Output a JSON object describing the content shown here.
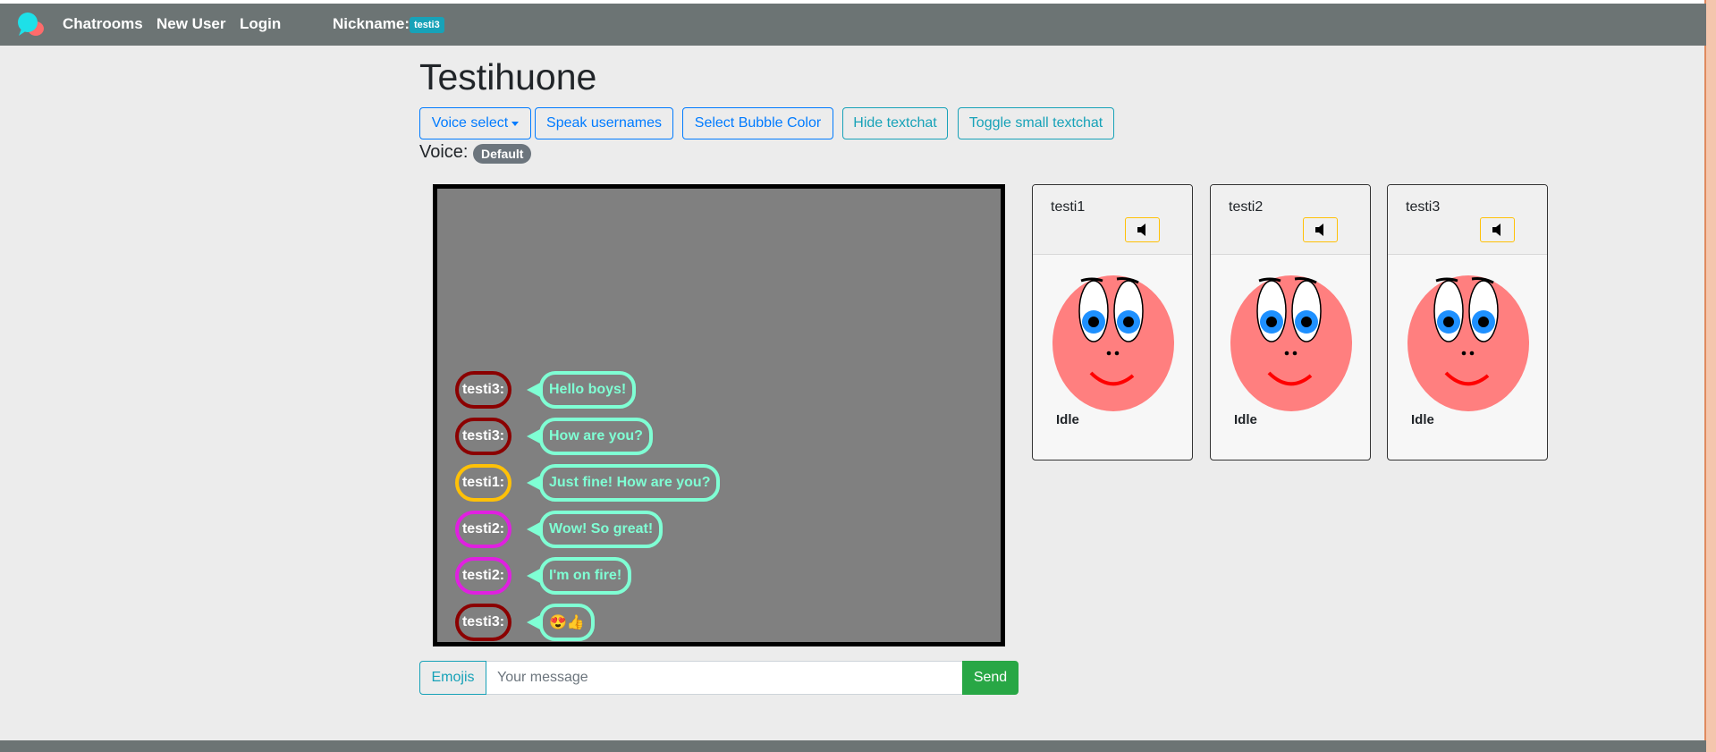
{
  "navbar": {
    "brand_icon": "chat-bubbles-logo-icon",
    "links": [
      "Chatrooms",
      "New User",
      "Login"
    ],
    "nickname_label": "Nickname:",
    "nickname_value": "testi3"
  },
  "room": {
    "title": "Testihuone",
    "buttons": {
      "voice_select": "Voice select",
      "speak_usernames": "Speak usernames",
      "select_bubble_color": "Select Bubble Color",
      "hide_textchat": "Hide textchat",
      "toggle_small_textchat": "Toggle small textchat"
    },
    "voice_label": "Voice:",
    "voice_value": "Default"
  },
  "chat": {
    "messages": [
      {
        "user": "testi3:",
        "text": "Hello boys!",
        "user_color": "#8b0000"
      },
      {
        "user": "testi3:",
        "text": "How are you?",
        "user_color": "#8b0000"
      },
      {
        "user": "testi1:",
        "text": "Just fine! How are you?",
        "user_color": "#ffc107"
      },
      {
        "user": "testi2:",
        "text": "Wow! So great!",
        "user_color": "#e020e0"
      },
      {
        "user": "testi2:",
        "text": "I'm on fire!",
        "user_color": "#e020e0"
      },
      {
        "user": "testi3:",
        "text": "😍👍",
        "user_color": "#8b0000"
      }
    ],
    "bubble_color": "#7fffd4"
  },
  "composer": {
    "emojis_label": "Emojis",
    "placeholder": "Your message",
    "send_label": "Send"
  },
  "users": [
    {
      "name": "testi1",
      "status": "Idle",
      "mute_icon": "speaker-icon"
    },
    {
      "name": "testi2",
      "status": "Idle",
      "mute_icon": "speaker-icon"
    },
    {
      "name": "testi3",
      "status": "Idle",
      "mute_icon": "speaker-icon"
    }
  ],
  "colors": {
    "navbar": "#6c7474",
    "primary": "#007bff",
    "info": "#17a2b8",
    "success": "#28a745",
    "face": "#ff7f7f"
  }
}
